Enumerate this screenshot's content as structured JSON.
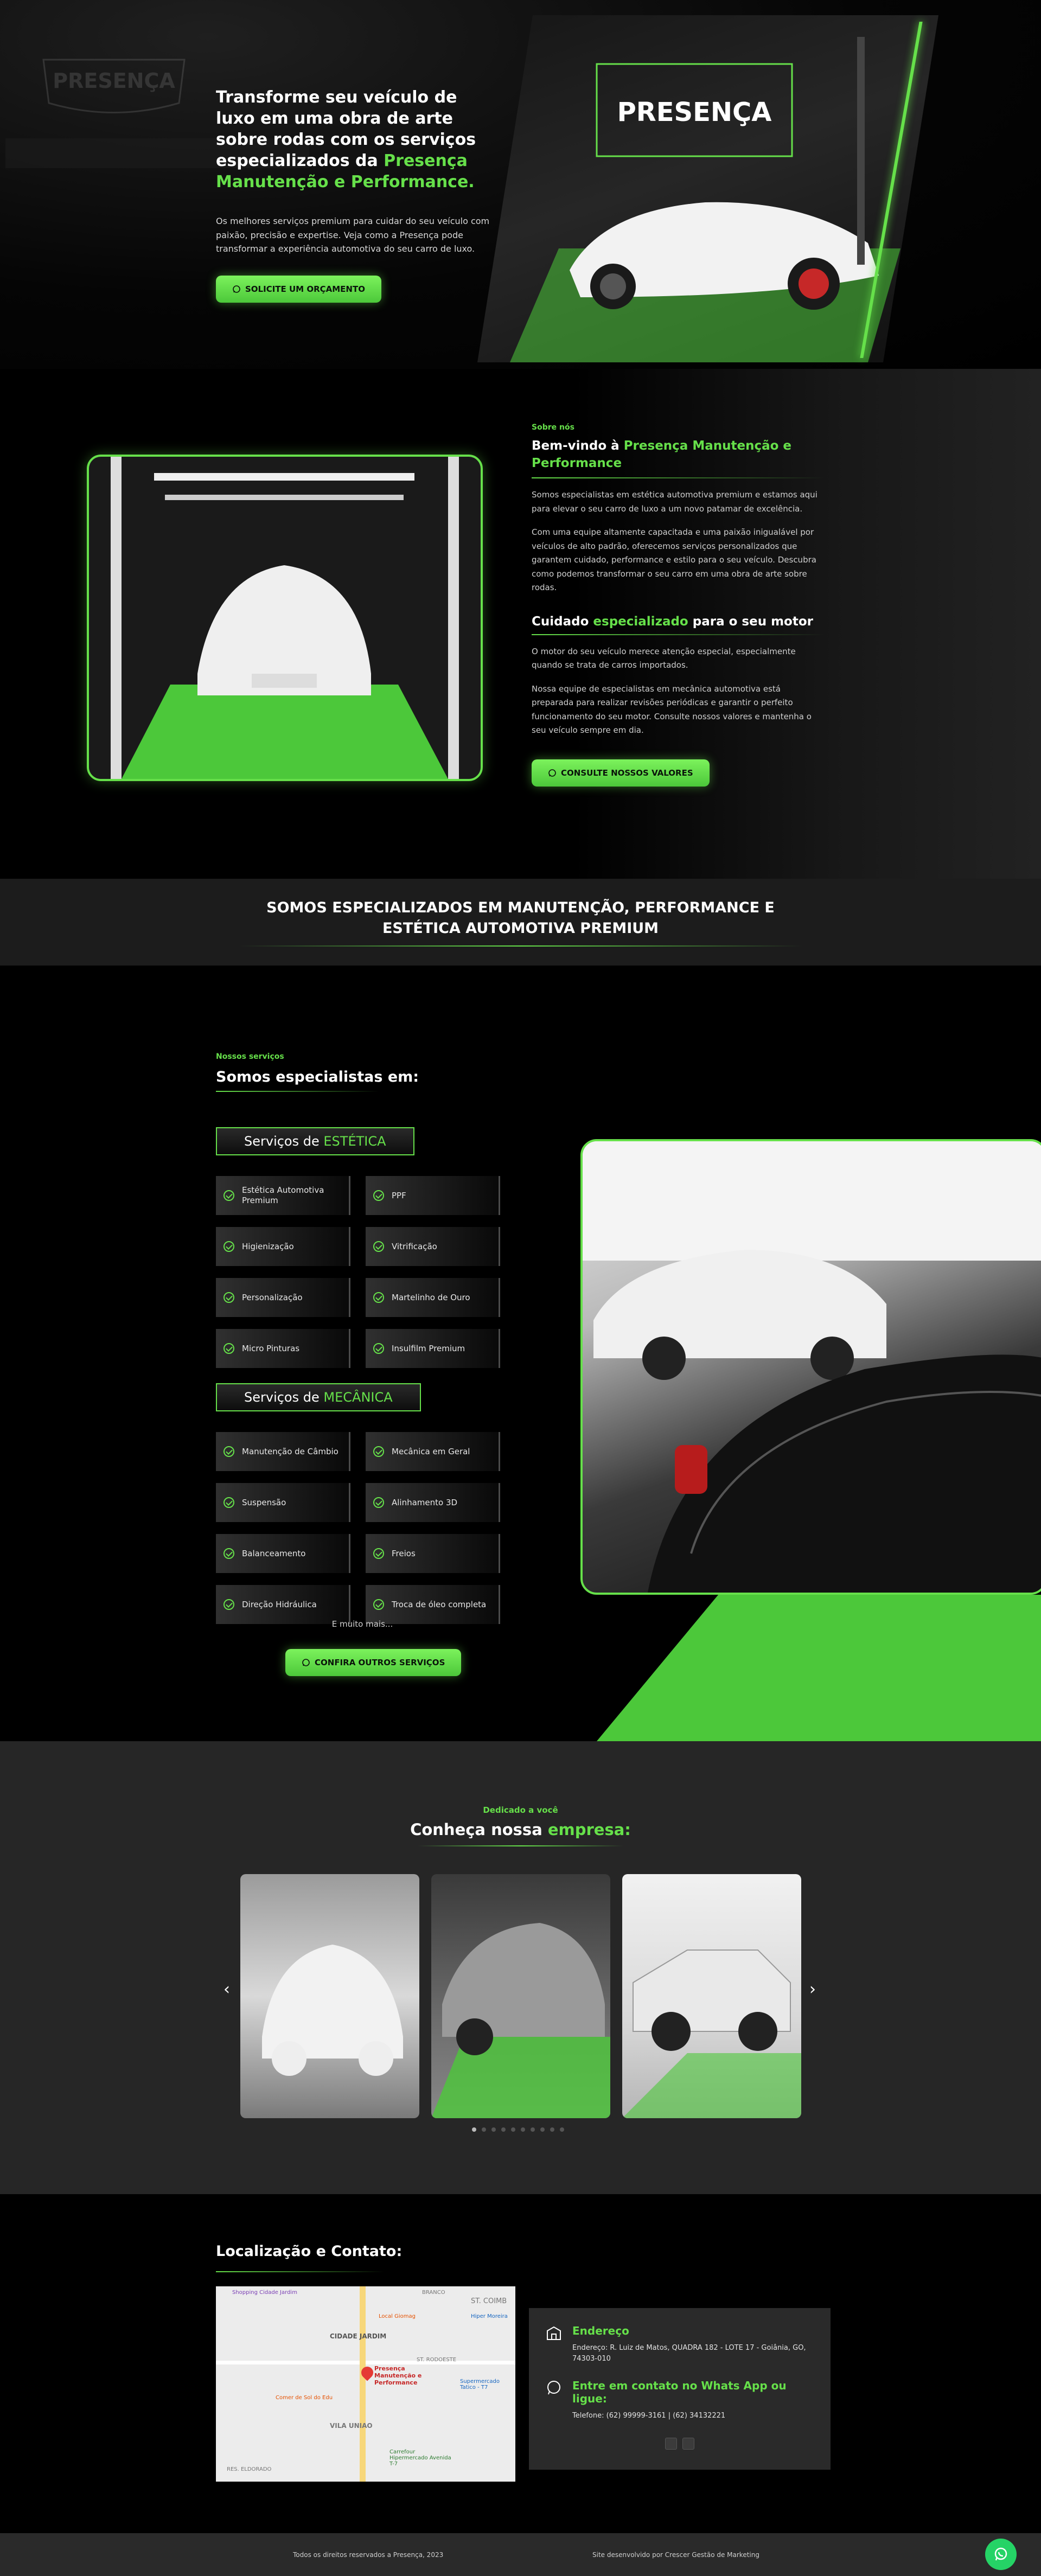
{
  "hero": {
    "logo_text": "PRESENÇA",
    "title_part1": "Transforme seu veículo de luxo em uma obra de arte sobre rodas com os serviços especializados da ",
    "title_highlight": "Presença Manutenção e Performance.",
    "description": "Os melhores serviços premium para cuidar do seu veículo com paixão, precisão e expertise. Veja como a Presença pode transformar a experiência automotiva do seu carro de luxo.",
    "cta_label": "SOLICITE UM ORÇAMENTO"
  },
  "about": {
    "eyebrow": "Sobre nós",
    "title_part1": "Bem-vindo à ",
    "title_highlight": "Presença Manutenção e Performance",
    "p1": "Somos especialistas em estética automotiva premium e estamos aqui para elevar o seu carro de luxo a um novo patamar de excelência.",
    "p2": "Com uma equipe altamente capacitada e uma paixão inigualável por veículos de alto padrão, oferecemos serviços personalizados que garantem cuidado, performance e estilo para o seu veículo. Descubra como podemos transformar o seu carro em uma obra de arte sobre rodas.",
    "subtitle_part1": "Cuidado ",
    "subtitle_highlight": "especializado",
    "subtitle_part2": " para o seu motor",
    "p3": "O motor do seu veículo merece atenção especial, especialmente quando se trata de carros importados.",
    "p4": "Nossa equipe de especialistas em mecânica automotiva está preparada para realizar revisões periódicas e garantir o perfeito funcionamento do seu motor. Consulte nossos valores e mantenha o seu veículo sempre em dia.",
    "cta_label": "CONSULTE NOSSOS VALORES"
  },
  "banner": {
    "title": "SOMOS ESPECIALIZADOS EM MANUTENÇÃO, PERFORMANCE E ESTÉTICA AUTOMOTIVA PREMIUM"
  },
  "services": {
    "eyebrow": "Nossos serviços",
    "title": "Somos especialistas em:",
    "estetica": {
      "head_prefix": "Serviços de ",
      "head_highlight": "ESTÉTICA",
      "items": [
        "Estética Automotiva Premium",
        "PPF",
        "Higienização",
        "Vitrificação",
        "Personalização",
        "Martelinho de Ouro",
        "Micro Pinturas",
        "Insulfilm Premium"
      ]
    },
    "mecanica": {
      "head_prefix": "Serviços de ",
      "head_highlight": "MECÂNICA",
      "items": [
        "Manutenção de Câmbio",
        "Mecânica em Geral",
        "Suspensão",
        "Alinhamento 3D",
        "Balanceamento",
        "Freios",
        "Direção Hidráulica",
        "Troca de óleo completa"
      ]
    },
    "more": "E muito mais...",
    "cta_label": "CONFIRA OUTROS SERVIÇOS"
  },
  "company": {
    "eyebrow": "Dedicado a você",
    "title_part1": "Conheça nossa ",
    "title_highlight": "empresa:",
    "prev_arrow": "‹",
    "next_arrow": "›",
    "dots_count": 10
  },
  "contact": {
    "title": "Localização e Contato:",
    "map": {
      "pin_label": "Presença Manutenção e Performance",
      "labels": [
        "Shopping Cidade Jardim",
        "BRANCO",
        "ST. COIMB",
        "CIDADE JARDIM",
        "ST. RODOESTE",
        "Carrefour Hipermercado Avenida T-7",
        "VILA UNIAO",
        "RES. ELDORADO",
        "Supermercado Tatico - T7",
        "Hiper Moreira",
        "Local Giomag",
        "Comer de Sol do Edu"
      ]
    },
    "address_title": "Endereço",
    "address_text": "Endereço: R. Luiz de Matos, QUADRA 182 - LOTE 17 - Goiânia, GO, 74303-010",
    "whats_title": "Entre em contato no Whats App ou ligue:",
    "phone_text": "Telefone: (62) 99999-3161 | (62) 34132221"
  },
  "footer": {
    "left": "Todos os direitos reservados a Presença, 2023",
    "right": "Site desenvolvido por Crescer Gestão de Marketing"
  },
  "colors": {
    "accent": "#66e04a",
    "accent_dark": "#4cc83a",
    "whatsapp": "#25d366"
  }
}
